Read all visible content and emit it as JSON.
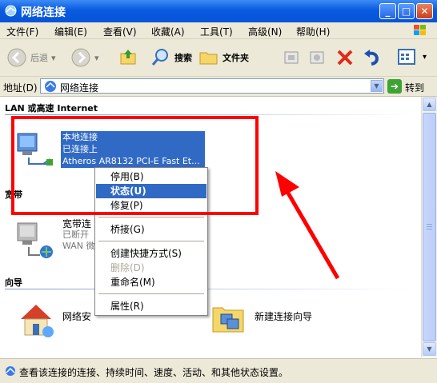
{
  "window": {
    "title": "网络连接"
  },
  "menu": [
    "文件(F)",
    "编辑(E)",
    "查看(V)",
    "收藏(A)",
    "工具(T)",
    "高级(N)",
    "帮助(H)"
  ],
  "toolbar": {
    "back": "后退",
    "search": "搜索",
    "folders": "文件夹"
  },
  "address": {
    "label": "地址(D)",
    "value": "网络连接",
    "go": "转到"
  },
  "sections": {
    "lan": "LAN 或高速 Internet",
    "broadband": "宽带",
    "wizard": "向导"
  },
  "lan_item": {
    "name": "本地连接",
    "status": "已连接上",
    "device": "Atheros AR8132 PCI-E Fast Et..."
  },
  "broadband_item": {
    "name": "宽带连",
    "status": "已断开",
    "device": "WAN 微"
  },
  "wizard_items": [
    {
      "name": "网络安"
    },
    {
      "name": "新建连接向导"
    }
  ],
  "context_menu": [
    {
      "label": "停用(B)",
      "state": "normal"
    },
    {
      "label": "状态(U)",
      "state": "highlighted"
    },
    {
      "label": "修复(P)",
      "state": "normal"
    },
    {
      "label": "桥接(G)",
      "state": "normal"
    },
    {
      "label": "创建快捷方式(S)",
      "state": "normal"
    },
    {
      "label": "删除(D)",
      "state": "disabled"
    },
    {
      "label": "重命名(M)",
      "state": "normal"
    },
    {
      "label": "属性(R)",
      "state": "normal"
    }
  ],
  "statusbar": {
    "text": "查看该连接的连接、持续时间、速度、活动、和其他状态设置。"
  },
  "colors": {
    "title_bar": "#0a5be0",
    "selection": "#316ac5",
    "annotation": "#ff0000",
    "chrome": "#ece9d8"
  }
}
